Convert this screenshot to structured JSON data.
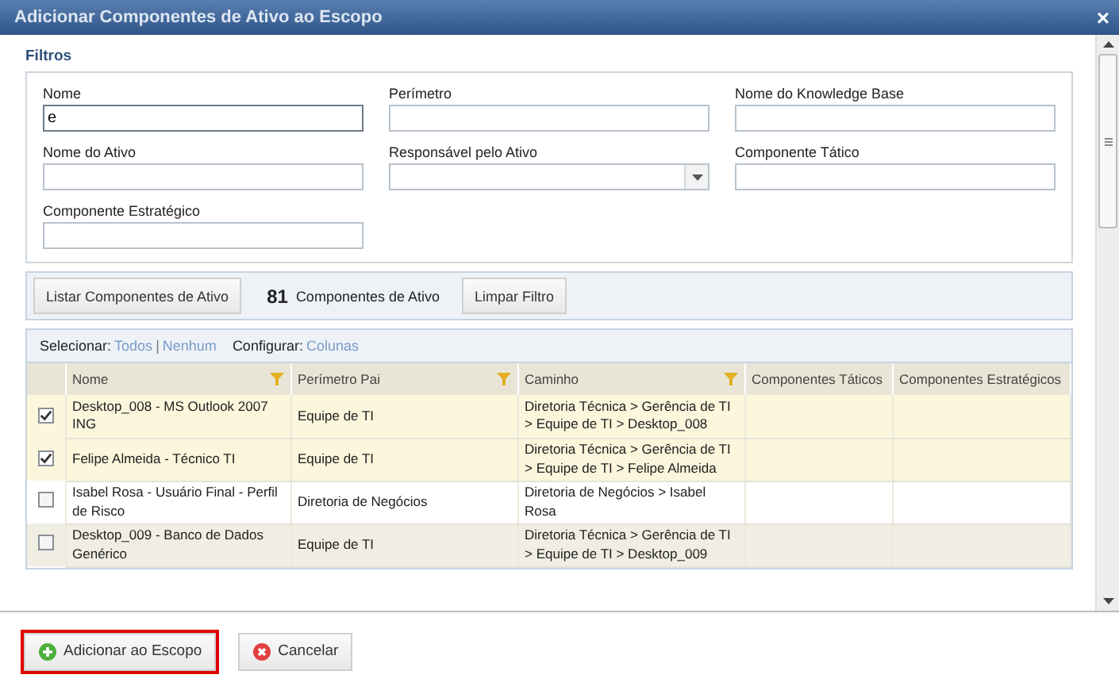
{
  "window": {
    "title": "Adicionar Componentes de Ativo ao Escopo",
    "close": "×"
  },
  "filters": {
    "title": "Filtros",
    "fields": [
      {
        "label": "Nome",
        "kind": "text",
        "value": "e",
        "focused": true
      },
      {
        "label": "Perímetro",
        "kind": "text",
        "focused": false
      },
      {
        "label": "Nome do Knowledge Base",
        "kind": "text",
        "focused": false
      },
      {
        "label": "Nome do Ativo",
        "kind": "text",
        "focused": false
      },
      {
        "label": "Responsável pelo Ativo",
        "kind": "select",
        "focused": false
      },
      {
        "label": "Componente Tático",
        "kind": "text",
        "focused": false
      },
      {
        "label": "Componente Estratégico",
        "kind": "text",
        "focused": false
      }
    ]
  },
  "toolbar": {
    "list_button": "Listar Componentes de Ativo",
    "count": "81",
    "count_label": "Componentes de Ativo",
    "clear_button": "Limpar Filtro"
  },
  "grid": {
    "select_label": "Selecionar:",
    "select_all": "Todos",
    "separator": "|",
    "select_none": "Nenhum",
    "configure_label": "Configurar:",
    "columns_link": "Colunas",
    "columns": [
      {
        "label": "Nome",
        "filter": true
      },
      {
        "label": "Perímetro Pai",
        "filter": true
      },
      {
        "label": "Caminho",
        "filter": true
      },
      {
        "label": "Componentes Táticos",
        "filter": false
      },
      {
        "label": "Componentes Estratégicos",
        "filter": false
      }
    ],
    "rows": [
      {
        "checked": true,
        "cells": [
          "Desktop_008 - MS Outlook 2007 ING",
          "Equipe de TI",
          "Diretoria Técnica > Gerência de TI > Equipe de TI > Desktop_008",
          "",
          ""
        ]
      },
      {
        "checked": true,
        "cells": [
          "Felipe Almeida - Técnico TI",
          "Equipe de TI",
          "Diretoria Técnica > Gerência de TI > Equipe de TI > Felipe Almeida",
          "",
          ""
        ]
      },
      {
        "checked": false,
        "cells": [
          "Isabel Rosa - Usuário Final - Perfil de Risco",
          "Diretoria de Negócios",
          "Diretoria de Negócios > Isabel Rosa",
          "",
          ""
        ]
      },
      {
        "checked": false,
        "cells": [
          "Desktop_009 - Banco de Dados Genérico",
          "Equipe de TI",
          "Diretoria Técnica > Gerência de TI > Equipe de TI > Desktop_009",
          "",
          ""
        ]
      }
    ]
  },
  "footer": {
    "buttons": [
      {
        "label": "Adicionar ao Escopo",
        "kind": "add",
        "highlighted": true
      },
      {
        "label": "Cancelar",
        "kind": "cancel",
        "highlighted": false
      }
    ]
  }
}
